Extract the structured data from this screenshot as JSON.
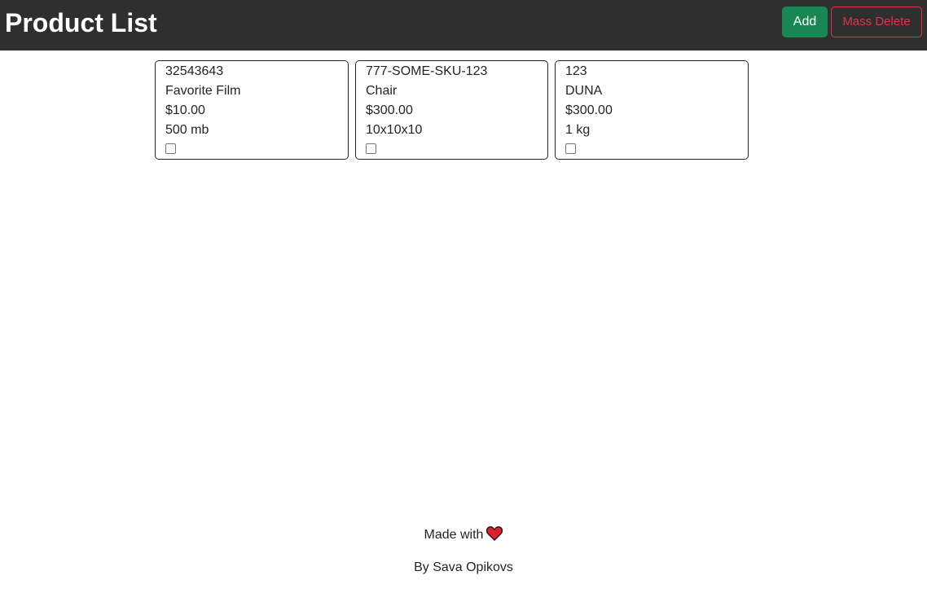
{
  "header": {
    "title": "Product List",
    "add_label": "Add",
    "mass_delete_label": "Mass Delete"
  },
  "products": [
    {
      "sku": "32543643",
      "name": "Favorite Film",
      "price": "$10.00",
      "attribute": "500 mb",
      "checked": false
    },
    {
      "sku": "777-SOME-SKU-123",
      "name": "Chair",
      "price": "$300.00",
      "attribute": "10x10x10",
      "checked": false
    },
    {
      "sku": "123",
      "name": "DUNA",
      "price": "$300.00",
      "attribute": "1 kg",
      "checked": false
    }
  ],
  "footer": {
    "made_with": "Made with",
    "heart_icon": "heart-icon",
    "author": "By Sava Opikovs"
  },
  "colors": {
    "header_bg": "#2f2f2f",
    "add_green": "#198754",
    "delete_red": "#dc3545",
    "heart_red": "#e0202a"
  }
}
